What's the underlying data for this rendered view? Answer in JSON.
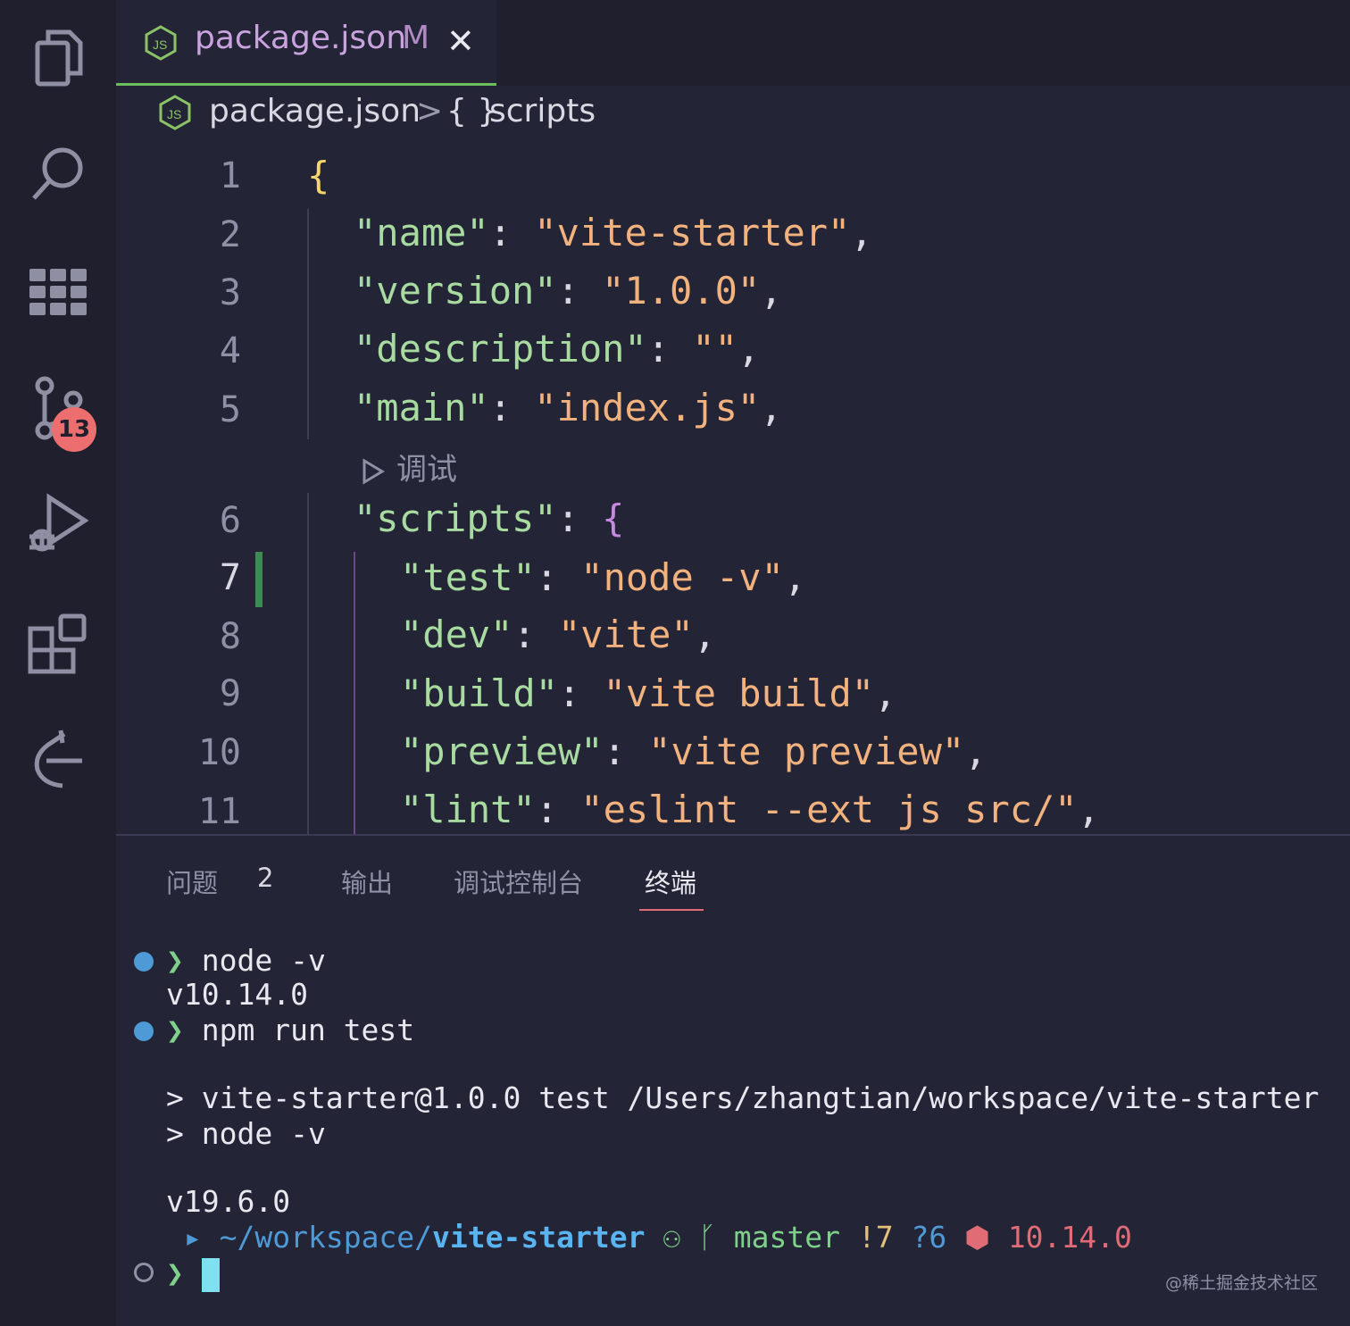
{
  "tab": {
    "filename": "package.json",
    "status": "M",
    "close": "✕"
  },
  "breadcrumb": {
    "file": "package.json",
    "sep": ">",
    "node_icon": "{ }",
    "node": "scripts"
  },
  "activity": {
    "scm_badge": "13"
  },
  "editor": {
    "line_numbers": [
      "1",
      "2",
      "3",
      "4",
      "5",
      "6",
      "7",
      "8",
      "9",
      "10",
      "11"
    ],
    "codelens": "调试",
    "lines": {
      "l1": {
        "open": "{"
      },
      "l2": {
        "key": "\"name\"",
        "colon": ": ",
        "value": "\"vite-starter\"",
        "comma": ","
      },
      "l3": {
        "key": "\"version\"",
        "colon": ": ",
        "value": "\"1.0.0\"",
        "comma": ","
      },
      "l4": {
        "key": "\"description\"",
        "colon": ": ",
        "value": "\"\"",
        "comma": ","
      },
      "l5": {
        "key": "\"main\"",
        "colon": ": ",
        "value": "\"index.js\"",
        "comma": ","
      },
      "l6": {
        "key": "\"scripts\"",
        "colon": ": ",
        "open": "{"
      },
      "l7": {
        "key": "\"test\"",
        "colon": ": ",
        "value": "\"node -v\"",
        "comma": ","
      },
      "l8": {
        "key": "\"dev\"",
        "colon": ": ",
        "value": "\"vite\"",
        "comma": ","
      },
      "l9": {
        "key": "\"build\"",
        "colon": ": ",
        "value": "\"vite build\"",
        "comma": ","
      },
      "l10": {
        "key": "\"preview\"",
        "colon": ": ",
        "value": "\"vite preview\"",
        "comma": ","
      },
      "l11": {
        "key": "\"lint\"",
        "colon": ": ",
        "value": "\"eslint --ext js src/\"",
        "comma": ","
      }
    }
  },
  "panel": {
    "tabs": {
      "problems": "问题",
      "problems_count": "2",
      "output": "输出",
      "debug_console": "调试控制台",
      "terminal": "终端"
    }
  },
  "terminal": {
    "cmd1": "node -v",
    "out1": "v10.14.0",
    "cmd2": "npm run test",
    "out2a": "> vite-starter@1.0.0 test /Users/zhangtian/workspace/vite-starter",
    "out2b": "> node -v",
    "out3": "v19.6.0",
    "prompt_path_prefix": "~/workspace/",
    "prompt_path_dir": "vite-starter",
    "git_branch": "master",
    "git_modified": "!7",
    "git_untracked": "?6",
    "node_version": "10.14.0"
  },
  "watermark": "@稀土掘金技术社区",
  "colors": {
    "accent_green": "#6cbd5b",
    "badge_red": "#ec6e6e",
    "string": "#f2b27e",
    "key": "#a8dba0",
    "cursor": "#7fe0f0"
  }
}
